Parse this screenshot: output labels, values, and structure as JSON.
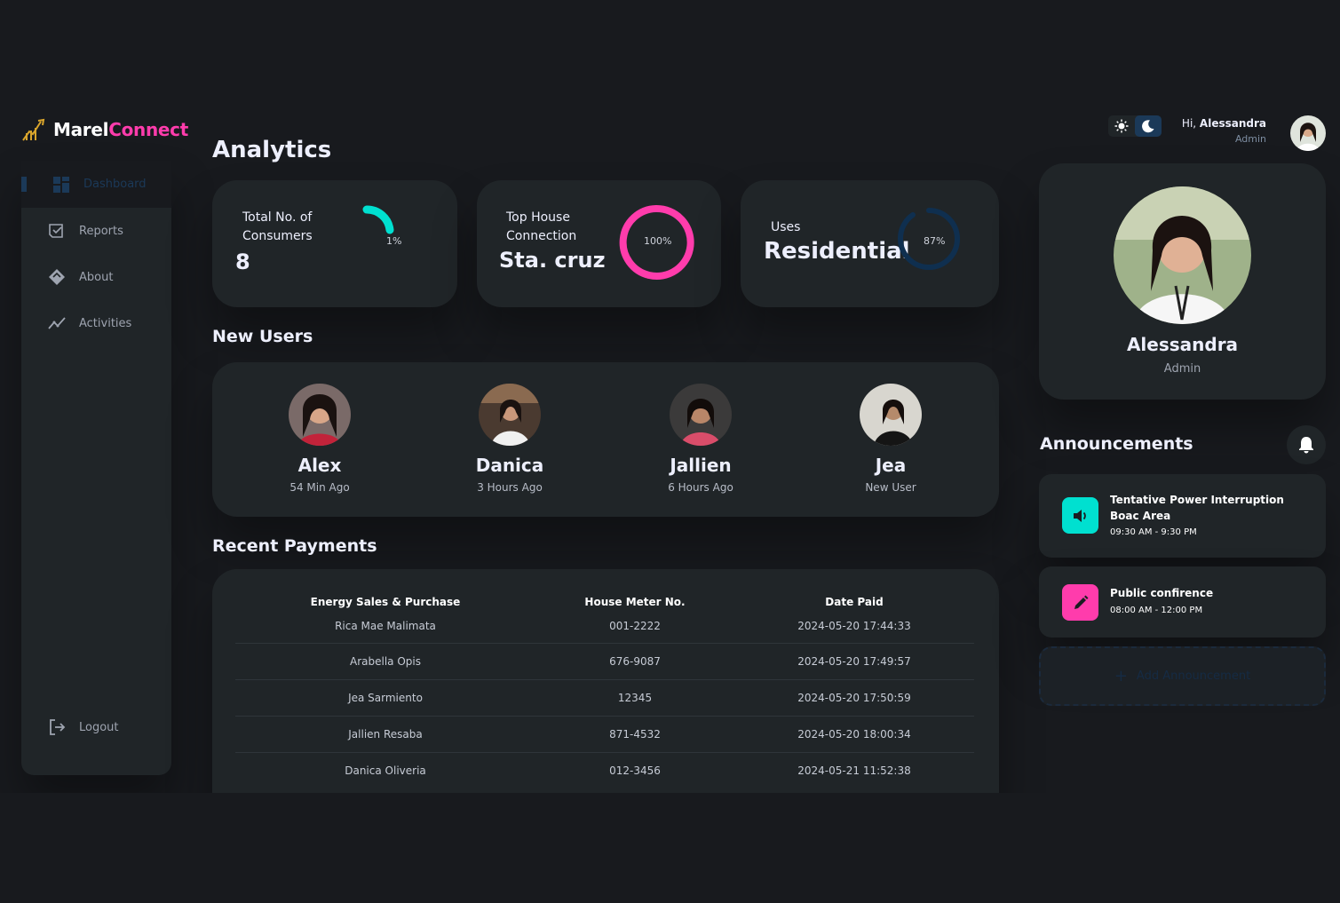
{
  "brand": {
    "part1": "Marel",
    "part2": "Connect"
  },
  "sidebar": {
    "items": [
      {
        "label": "Dashboard"
      },
      {
        "label": "Reports"
      },
      {
        "label": "About"
      },
      {
        "label": "Activities"
      }
    ],
    "logout_label": "Logout"
  },
  "main": {
    "analytics_title": "Analytics",
    "stats": [
      {
        "label": "Total No. of Consumers",
        "value": "8",
        "percent_text": "1%",
        "percent": 1,
        "color": "#00e0d0"
      },
      {
        "label": "Top House Connection",
        "value": "Sta. cruz",
        "percent_text": "100%",
        "percent": 100,
        "color": "#ff3cac"
      },
      {
        "label": "Uses",
        "value": "Residential",
        "percent_text": "87%",
        "percent": 87,
        "color": "#0f2f4f"
      }
    ],
    "new_users_title": "New Users",
    "new_users": [
      {
        "name": "Alex",
        "time": "54 Min Ago"
      },
      {
        "name": "Danica",
        "time": "3 Hours Ago"
      },
      {
        "name": "Jallien",
        "time": "6 Hours Ago"
      },
      {
        "name": "Jea",
        "time": "New User"
      }
    ],
    "payments_title": "Recent Payments",
    "payments": {
      "headers": [
        "Energy Sales & Purchase",
        "House Meter No.",
        "Date Paid"
      ],
      "rows": [
        [
          "Rica Mae Malimata",
          "001-2222",
          "2024-05-20 17:44:33"
        ],
        [
          "Arabella Opis",
          "676-9087",
          "2024-05-20 17:49:57"
        ],
        [
          "Jea Sarmiento",
          "12345",
          "2024-05-20 17:50:59"
        ],
        [
          "Jallien Resaba",
          "871-4532",
          "2024-05-20 18:00:34"
        ],
        [
          "Danica Oliveria",
          "012-3456",
          "2024-05-21 11:52:38"
        ]
      ]
    }
  },
  "right": {
    "greeting_prefix": "Hi, ",
    "greeting_name": "Alessandra",
    "greeting_role": "Admin",
    "profile_name": "Alessandra",
    "profile_role": "Admin",
    "announcements_title": "Announcements",
    "announcements": [
      {
        "title": "Tentative Power Interruption Boac Area",
        "time": "09:30 AM - 9:30 PM",
        "icon": "speaker-icon",
        "color": "#00e0d0"
      },
      {
        "title": "Public confirence",
        "time": "08:00 AM - 12:00 PM",
        "icon": "pencil-icon",
        "color": "#ff3cac"
      }
    ],
    "add_announcement_label": "Add Announcement"
  },
  "colors": {
    "accent_pink": "#ff3cac",
    "accent_teal": "#00e0d0",
    "panel": "#202528",
    "background": "#181a1e"
  }
}
